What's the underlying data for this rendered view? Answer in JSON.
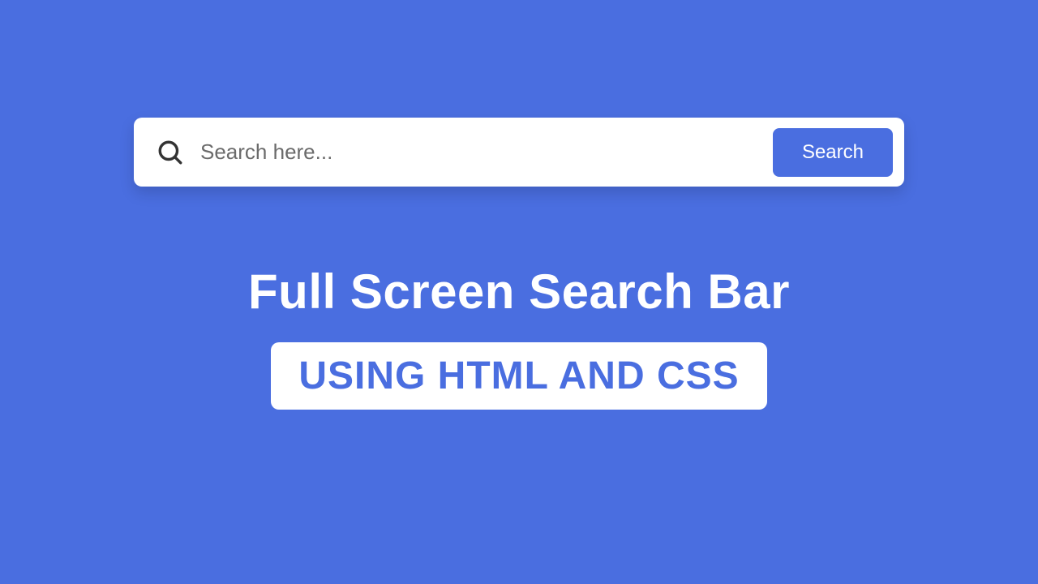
{
  "search": {
    "placeholder": "Search here...",
    "button_label": "Search"
  },
  "heading": {
    "title": "Full Screen Search Bar",
    "subtitle": "USING HTML AND CSS"
  },
  "colors": {
    "background": "#4a6ee0",
    "surface": "#ffffff",
    "placeholder": "#6b6b6b",
    "icon": "#333333"
  }
}
